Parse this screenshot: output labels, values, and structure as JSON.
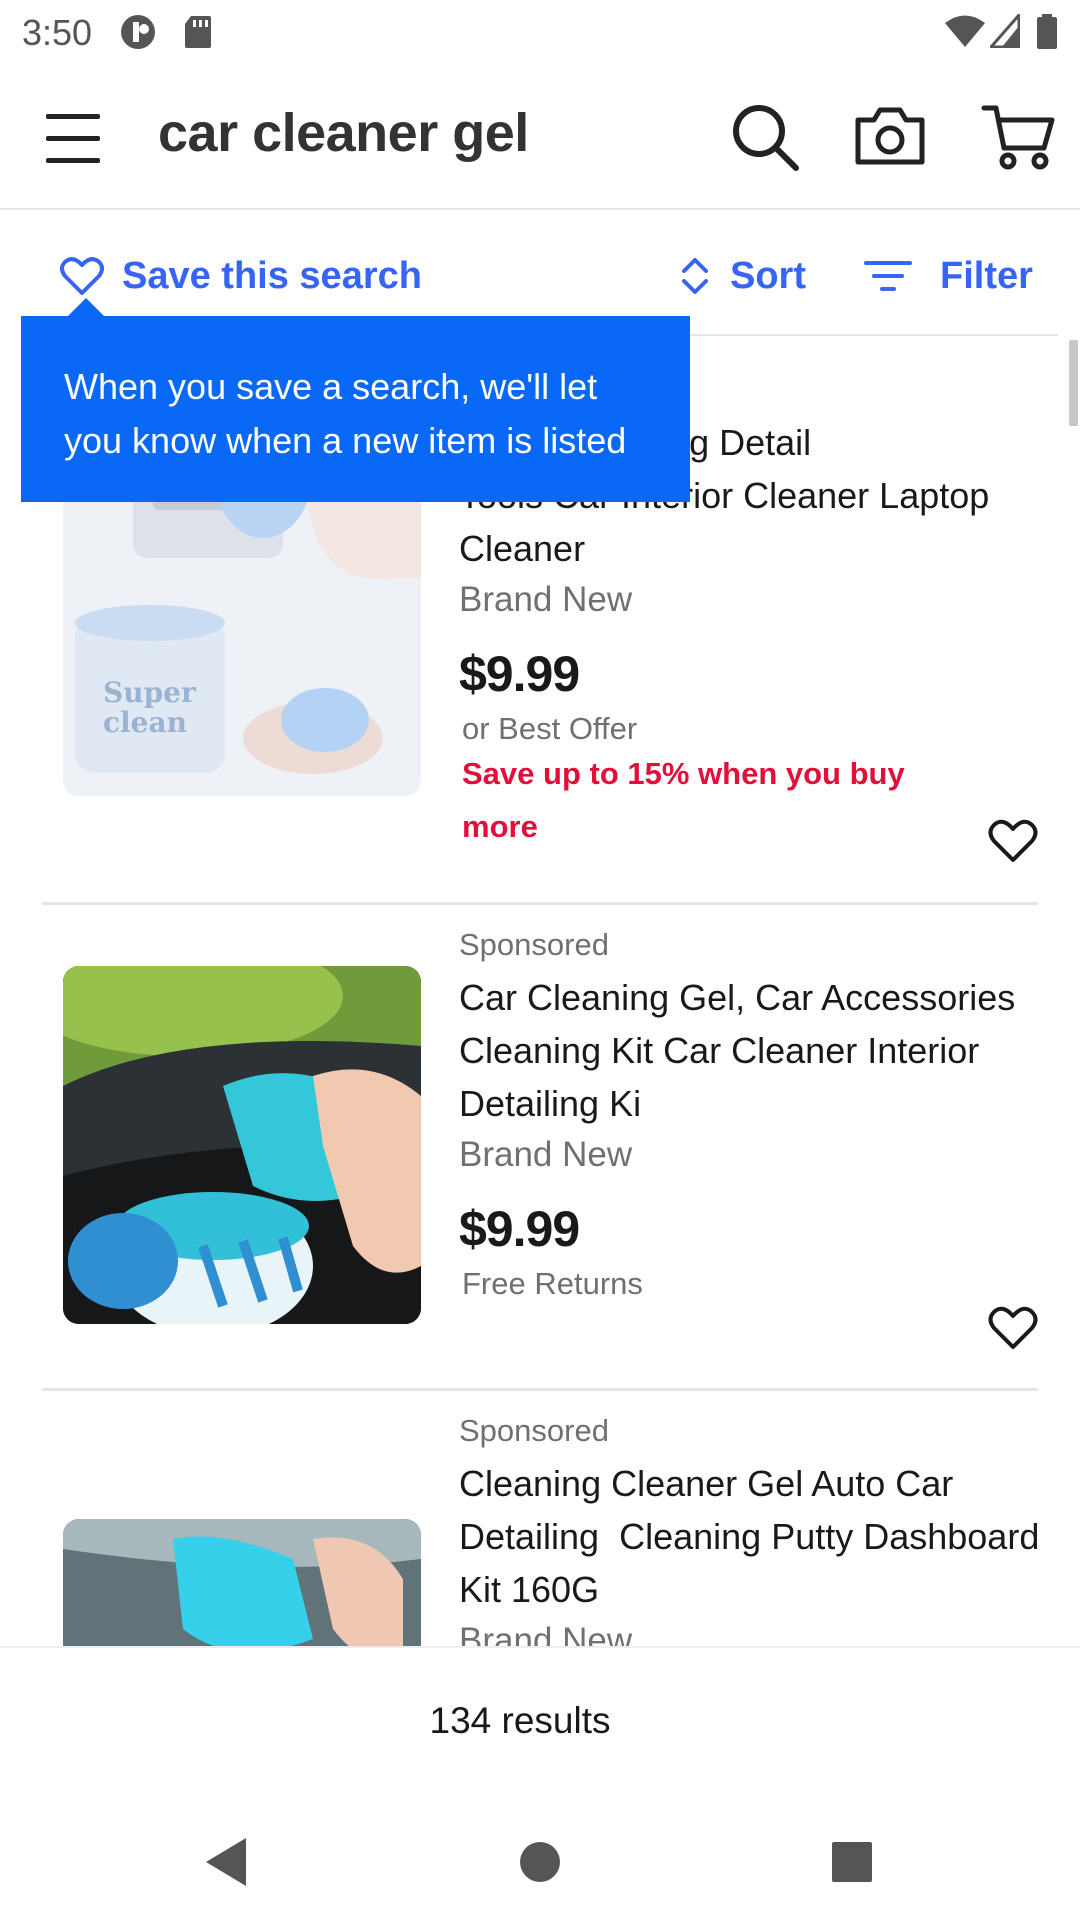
{
  "status_bar": {
    "time": "3:50",
    "icons": [
      "key-icon",
      "sd-card-icon",
      "wifi-icon",
      "signal-icon",
      "battery-icon"
    ]
  },
  "header": {
    "search_query": "car cleaner gel",
    "icons": [
      "menu-icon",
      "search-icon",
      "camera-icon",
      "cart-icon"
    ]
  },
  "actions": {
    "save_search_label": "Save this search",
    "sort_label": "Sort",
    "filter_label": "Filter"
  },
  "tooltip": {
    "text_line1": "When you save a search, we'll let",
    "text_line2": "you know when a new item is listed"
  },
  "listings": [
    {
      "title_line1": "or Car Detailing Detail",
      "title_line2": "Tools Car Interior Cleaner Laptop",
      "title_line3": "Cleaner",
      "condition": "Brand New",
      "price": "$9.99",
      "sub": "or Best Offer",
      "promo": "Save up to 15% when you buy more",
      "image_label": "Super clean"
    },
    {
      "sponsored": "Sponsored",
      "title_line1": "Car Cleaning Gel, Car Accessories",
      "title_line2": "Cleaning Kit Car Cleaner Interior",
      "title_line3": "Detailing Ki",
      "condition": "Brand New",
      "price": "$9.99",
      "sub": "Free Returns"
    },
    {
      "sponsored": "Sponsored",
      "title_line1": "Cleaning Cleaner Gel Auto Car",
      "title_line2": "Detailing  Cleaning Putty Dashboard",
      "title_line3": "Kit 160G",
      "condition": "Brand New"
    }
  ],
  "results": {
    "count_text": "134 results"
  },
  "colors": {
    "accent": "#3665f3",
    "tooltip_bg": "#0968f6",
    "promo": "#e0103a"
  }
}
